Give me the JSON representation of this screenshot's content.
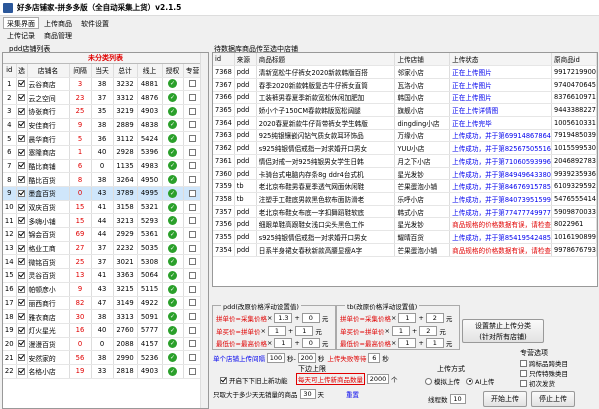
{
  "window": {
    "title": "好多店铺家-拼多多版（全自动采集上货）v2.1.5"
  },
  "menu": {
    "row1": [
      "采集界面",
      "上传商品",
      "软件设置"
    ],
    "row2": [
      "上传记录",
      "商品管理"
    ]
  },
  "left": {
    "group_label": "pdd店铺列表",
    "title": "未分类列表",
    "headers": [
      "id",
      "选",
      "店铺名",
      "间隔",
      "当天",
      "总计",
      "线上",
      "授权",
      "专营"
    ],
    "rows": [
      {
        "id": "1",
        "checked": true,
        "name": "云谷商店",
        "gap": "3",
        "today": "38",
        "total": "3232",
        "online": "4881",
        "auth": true,
        "zy": false
      },
      {
        "id": "2",
        "checked": true,
        "name": "云之空间",
        "gap": "23",
        "today": "37",
        "total": "3312",
        "online": "4876",
        "auth": true,
        "zy": false
      },
      {
        "id": "3",
        "checked": true,
        "name": "协张商行",
        "gap": "25",
        "today": "35",
        "total": "3219",
        "online": "4903",
        "auth": true,
        "zy": false
      },
      {
        "id": "4",
        "checked": true,
        "name": "安佳商行",
        "gap": "9",
        "today": "38",
        "total": "2889",
        "online": "4838",
        "auth": true,
        "zy": false
      },
      {
        "id": "5",
        "checked": true,
        "name": "晨华商行",
        "gap": "5",
        "today": "36",
        "total": "3112",
        "online": "5424",
        "auth": true,
        "zy": false
      },
      {
        "id": "6",
        "checked": true,
        "name": "塞隆商店",
        "gap": "1",
        "today": "40",
        "total": "2928",
        "online": "5396",
        "auth": true,
        "zy": false
      },
      {
        "id": "7",
        "checked": true,
        "name": "酷比商铺",
        "gap": "6",
        "today": "0",
        "total": "1135",
        "online": "4983",
        "auth": true,
        "zy": false
      },
      {
        "id": "8",
        "checked": true,
        "name": "酷比百货",
        "gap": "8",
        "today": "38",
        "total": "3264",
        "online": "4950",
        "auth": true,
        "zy": false
      },
      {
        "id": "9",
        "checked": true,
        "name": "墨盒百货",
        "gap": "0",
        "today": "43",
        "total": "3789",
        "online": "4995",
        "auth": true,
        "zy": false
      },
      {
        "id": "10",
        "checked": true,
        "name": "双庆百货",
        "gap": "15",
        "today": "41",
        "total": "3158",
        "online": "5321",
        "auth": true,
        "zy": false
      },
      {
        "id": "11",
        "checked": true,
        "name": "多嗨小铺",
        "gap": "15",
        "today": "44",
        "total": "3213",
        "online": "5293",
        "auth": true,
        "zy": false
      },
      {
        "id": "12",
        "checked": true,
        "name": "锦会百货",
        "gap": "69",
        "today": "44",
        "total": "2929",
        "online": "5361",
        "auth": true,
        "zy": false
      },
      {
        "id": "13",
        "checked": true,
        "name": "格业工商",
        "gap": "27",
        "today": "37",
        "total": "2232",
        "online": "5035",
        "auth": true,
        "zy": false
      },
      {
        "id": "14",
        "checked": true,
        "name": "微铭百货",
        "gap": "25",
        "today": "37",
        "total": "3021",
        "online": "5308",
        "auth": true,
        "zy": false
      },
      {
        "id": "15",
        "checked": true,
        "name": "灵谷百货",
        "gap": "13",
        "today": "41",
        "total": "3363",
        "online": "5064",
        "auth": true,
        "zy": false
      },
      {
        "id": "16",
        "checked": true,
        "name": "帕顿彦小",
        "gap": "9",
        "today": "43",
        "total": "3215",
        "online": "5115",
        "auth": true,
        "zy": false
      },
      {
        "id": "17",
        "checked": true,
        "name": "丽西商行",
        "gap": "82",
        "today": "47",
        "total": "3149",
        "online": "4922",
        "auth": true,
        "zy": false
      },
      {
        "id": "18",
        "checked": true,
        "name": "雅衣商店",
        "gap": "30",
        "today": "38",
        "total": "3313",
        "online": "5091",
        "auth": true,
        "zy": false
      },
      {
        "id": "19",
        "checked": true,
        "name": "灯火星光",
        "gap": "16",
        "today": "40",
        "total": "2760",
        "online": "5777",
        "auth": true,
        "zy": false
      },
      {
        "id": "20",
        "checked": true,
        "name": "漫漫百货",
        "gap": "0",
        "today": "0",
        "total": "2088",
        "online": "4157",
        "auth": true,
        "zy": false
      },
      {
        "id": "21",
        "checked": true,
        "name": "安然家的",
        "gap": "56",
        "today": "38",
        "total": "2990",
        "online": "5236",
        "auth": true,
        "zy": false
      },
      {
        "id": "22",
        "checked": true,
        "name": "名格小店",
        "gap": "19",
        "today": "33",
        "total": "2818",
        "online": "4903",
        "auth": true,
        "zy": false
      }
    ]
  },
  "right": {
    "label": "待数据库商品传至选中店铺",
    "headers": [
      "id",
      "来源",
      "商品标题",
      "上传店铺",
      "上传状态",
      "原商品id"
    ],
    "rows": [
      {
        "id": "7368",
        "src": "pdd",
        "title": "清新宽松牛仔裤女2020新款韩版百搭",
        "shop": "邻家小店",
        "status": "正在上传图片",
        "red": false,
        "pid": "9917219900"
      },
      {
        "id": "7367",
        "src": "pdd",
        "title": "春季2020新款韩版复古牛仔裤女直筒",
        "shop": "瓦洛小店",
        "status": "正在上传图片",
        "red": false,
        "pid": "9740470645"
      },
      {
        "id": "7366",
        "src": "pdd",
        "title": "工装裤男春夏季新款宽松休闲加肥加",
        "shop": "韩国小店",
        "status": "正在上传图片",
        "red": false,
        "pid": "8376610971"
      },
      {
        "id": "7365",
        "src": "pdd",
        "title": "娇小个子150CM春款韩版宽松阔腿",
        "shop": "旗舰小店",
        "status": "正在上传详情图",
        "red": false,
        "pid": "9443388227"
      },
      {
        "id": "7364",
        "src": "pdd",
        "title": "2020春夏新款牛仔背带裤女学生韩版",
        "shop": "dingding小店",
        "status": "正在上传完毕",
        "red": false,
        "pid": "1005610331"
      },
      {
        "id": "7363",
        "src": "pdd",
        "title": "925纯银镶嵌闪钻气质女款耳环饰品",
        "shop": "万缘小店",
        "status": "上传成功，并于第69914867864",
        "red": false,
        "pid": "7919485039"
      },
      {
        "id": "7362",
        "src": "pdd",
        "title": "s925纯银情侣戒指一对求婚开口男女",
        "shop": "YUU小店",
        "status": "上传成功，并于第82567505516",
        "red": false,
        "pid": "1015599530"
      },
      {
        "id": "7361",
        "src": "pdd",
        "title": "情侣对戒一对925纯银男女学生日韩",
        "shop": "月之下小店",
        "status": "上传成功，并于第71060593996",
        "red": false,
        "pid": "2046892783"
      },
      {
        "id": "7360",
        "src": "pdd",
        "title": "卡骑台式电脑内存条8g ddr4台式机",
        "shop": "星光发钞",
        "status": "上传成功，并于第84949643380",
        "red": false,
        "pid": "9939235936"
      },
      {
        "id": "7359",
        "src": "tb",
        "title": "老北京布鞋男春夏季透气网面休闲鞋",
        "shop": "芒果蛋泡小铺",
        "status": "上传成功，并于第84676915785",
        "red": false,
        "pid": "6109329592"
      },
      {
        "id": "7358",
        "src": "tb",
        "title": "注塑手工鞋底男款黑色软布面防滑老",
        "shop": "乐呼小店",
        "status": "上传成功，并于第84073951599",
        "red": false,
        "pid": "5476555414"
      },
      {
        "id": "7357",
        "src": "pdd",
        "title": "老北京布鞋女布底一字扣舞蹈鞋软底",
        "shop": "韩式小店",
        "status": "上传成功，并于第77477749977",
        "red": false,
        "pid": "5909870033"
      },
      {
        "id": "7356",
        "src": "pdd",
        "title": "细跟单鞋高跟鞋女浅口尖头黑色工作",
        "shop": "星光发钞",
        "status": "商品规格的价格数据有误，请检查",
        "red": true,
        "pid": "8022961"
      },
      {
        "id": "7355",
        "src": "pdd",
        "title": "s925纯银情侣戒指一对求婚开口男女",
        "shop": "耀晴百货",
        "status": "上传成功，并于第85419542485",
        "red": false,
        "pid": "1016190899"
      },
      {
        "id": "7354",
        "src": "pdd",
        "title": "日系半身裙女春秋新款高腰显瘦A字",
        "shop": "芒果蛋泡小铺",
        "status": "商品规格的价格数据有误，请检查",
        "red": true,
        "pid": "9978676793"
      }
    ]
  },
  "pdd_panel": {
    "title": "pdd(改原价格浮动设置值)",
    "rows": [
      {
        "label": "拼单价=采集价格",
        "op1": "1.3",
        "op2": "0",
        "unit": "元"
      },
      {
        "label": "单买价=拼单价",
        "op1": "1",
        "op2": "1",
        "unit": "元"
      },
      {
        "label": "最低价=最高价格",
        "op1": "1",
        "op2": "0",
        "unit": "元"
      }
    ]
  },
  "tb_panel": {
    "title": "tb(改原价格浮动设置值)",
    "rows": [
      {
        "label": "拼单价=采集价格",
        "op1": "1",
        "op2": "2",
        "unit": "元"
      },
      {
        "label": "单买价=拼单价",
        "op1": "1",
        "op2": "2",
        "unit": "元"
      },
      {
        "label": "最低价=最高价格",
        "op1": "1",
        "op2": "1",
        "unit": "元"
      }
    ]
  },
  "controls": {
    "interval_label": "单个店铺上传间隔",
    "interval_from": "100",
    "interval_sep": "秒-",
    "interval_to": "200",
    "interval_unit": "秒",
    "wait_label": "上传失败等待",
    "wait_value": "6",
    "wait_unit": "秒",
    "reset_label": "重置",
    "limit_label": "下边上限",
    "open_btn_label": "开启下下旧上新功能",
    "per_day_label": "每天可上传新商品数量",
    "per_day_value": "2000",
    "per_day_unit": "个",
    "only_label": "只取大于多少天无销量的商品",
    "only_value": "30",
    "only_unit": "天",
    "set_category_btn": "设置禁止上传分类\n(针对所有店铺)",
    "zy_group": "专营选项",
    "zy_opt1": "跨标品跨类目",
    "zy_opt2": "只传特殊类目",
    "zy_opt3": "初次发货",
    "upload_mode_label": "上传方式",
    "mode_simulate": "模拟上传",
    "mode_ai": "AI上传",
    "threads_label": "线程数",
    "threads_value": "10",
    "start_btn": "开始上传",
    "stop_btn": "停止上传"
  },
  "icons": {
    "check": "check-icon",
    "app": "app-icon"
  },
  "colors": {
    "accent": "#e00000",
    "link": "#0000ee",
    "ok": "#2ba02b"
  }
}
